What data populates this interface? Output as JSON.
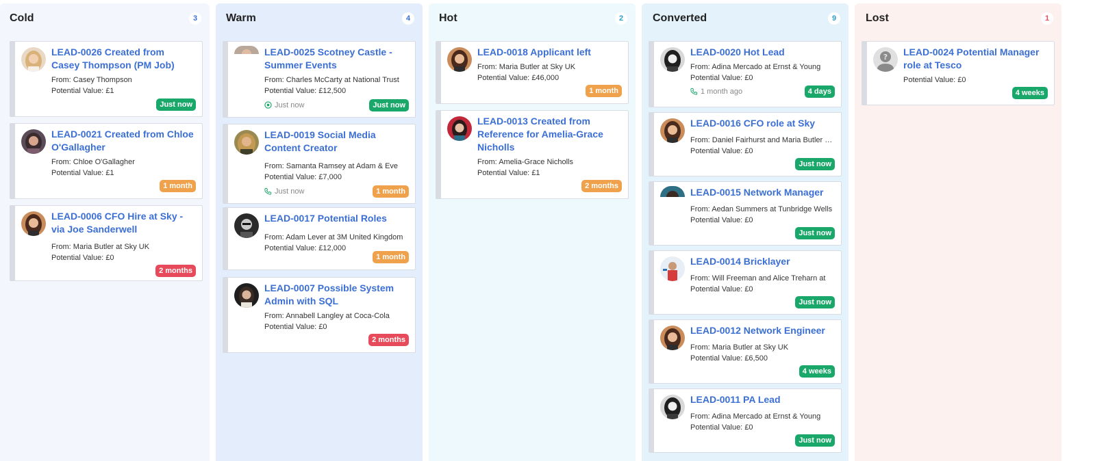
{
  "columns": [
    {
      "title": "Cold",
      "count": "3",
      "color": "#f3f6fd",
      "count_color": "#3b6fd4"
    },
    {
      "title": "Warm",
      "count": "4",
      "color": "#e4edfb",
      "count_color": "#3b6fd4"
    },
    {
      "title": "Hot",
      "count": "2",
      "color": "#eef9fd",
      "count_color": "#2b9fcf"
    },
    {
      "title": "Converted",
      "count": "9",
      "color": "#e3f2fb",
      "count_color": "#2b9fcf"
    },
    {
      "title": "Lost",
      "count": "1",
      "color": "#fdf1f0",
      "count_color": "#e74a5a"
    }
  ],
  "cards": {
    "cold": [
      {
        "title": "LEAD-0026 Created from Casey Thompson (PM Job)",
        "from_label": "From:",
        "from": "Casey Thompson",
        "value_label": "Potential Value:",
        "value": "£1",
        "badge": "Just now",
        "badge_color": "green",
        "avatar": "woman-blonde-avatar"
      },
      {
        "title": "LEAD-0021 Created from Chloe O'Gallagher",
        "from_label": "From:",
        "from": "Chloe O'Gallagher",
        "value_label": "Potential Value:",
        "value": "£1",
        "badge": "1 month",
        "badge_color": "orange",
        "avatar": "woman-dark-avatar"
      },
      {
        "title": "LEAD-0006 CFO Hire at Sky - via Joe Sanderwell",
        "from_label": "From:",
        "from": "Maria Butler at Sky UK",
        "value_label": "Potential Value:",
        "value": "£0",
        "badge": "2 months",
        "badge_color": "red",
        "avatar": "woman-brown-avatar"
      }
    ],
    "warm": [
      {
        "title": "LEAD-0025 Scotney Castle - Summer Events",
        "from_label": "From:",
        "from": "Charles McCarty at National Trust",
        "value_label": "Potential Value:",
        "value": "£12,500",
        "activity": "Just now",
        "activity_icon": "target-icon",
        "badge": "Just now",
        "badge_color": "green",
        "avatar": "man-avatar"
      },
      {
        "title": "LEAD-0019 Social Media Content Creator",
        "from_label": "From:",
        "from": "Samanta Ramsey at Adam & Eve",
        "value_label": "Potential Value:",
        "value": "£7,000",
        "activity": "Just now",
        "activity_icon": "phone-icon",
        "badge": "1 month",
        "badge_color": "orange",
        "avatar": "woman-blonde-avatar"
      },
      {
        "title": "LEAD-0017 Potential Roles",
        "from_label": "From:",
        "from": "Adam Lever at 3M United Kingdom",
        "value_label": "Potential Value:",
        "value": "£12,000",
        "badge": "1 month",
        "badge_color": "orange",
        "avatar": "man-dark-avatar"
      },
      {
        "title": "LEAD-0007 Possible System Admin with SQL",
        "from_label": "From:",
        "from": "Annabell Langley at Coca-Cola",
        "value_label": "Potential Value:",
        "value": "£0",
        "badge": "2 months",
        "badge_color": "red",
        "avatar": "woman-dark-avatar"
      }
    ],
    "hot": [
      {
        "title": "LEAD-0018 Applicant left",
        "from_label": "From:",
        "from": "Maria Butler at Sky UK",
        "value_label": "Potential Value:",
        "value": "£46,000",
        "badge": "1 month",
        "badge_color": "orange",
        "avatar": "woman-brown-avatar"
      },
      {
        "title": "LEAD-0013 Created from Reference for Amelia-Grace Nicholls",
        "from_label": "From:",
        "from": "Amelia-Grace Nicholls",
        "value_label": "Potential Value:",
        "value": "£1",
        "badge": "2 months",
        "badge_color": "orange",
        "avatar": "woman-red-avatar"
      }
    ],
    "converted": [
      {
        "title": "LEAD-0020 Hot Lead",
        "from_label": "From:",
        "from": "Adina Mercado at Ernst & Young",
        "value_label": "Potential Value:",
        "value": "£0",
        "activity": "1 month ago",
        "activity_icon": "phone-icon",
        "badge": "4 days",
        "badge_color": "green",
        "avatar": "woman-bw-avatar"
      },
      {
        "title": "LEAD-0016 CFO role at Sky",
        "from_label": "From:",
        "from": "Daniel Fairhurst and Maria Butler at Sky UK",
        "value_label": "Potential Value:",
        "value": "£0",
        "badge": "Just now",
        "badge_color": "green",
        "avatar": "woman-brown-avatar"
      },
      {
        "title": "LEAD-0015 Network Manager",
        "from_label": "From:",
        "from": "Aedan Summers at Tunbridge Wells",
        "value_label": "Potential Value:",
        "value": "£0",
        "badge": "Just now",
        "badge_color": "green",
        "avatar": "man-teal-avatar"
      },
      {
        "title": "LEAD-0014 Bricklayer",
        "from_label": "From:",
        "from": "Will Freeman and Alice Treharn at",
        "value_label": "Potential Value:",
        "value": "£0",
        "badge": "Just now",
        "badge_color": "green",
        "avatar": "man-sport-avatar"
      },
      {
        "title": "LEAD-0012 Network Engineer",
        "from_label": "From:",
        "from": "Maria Butler at Sky UK",
        "value_label": "Potential Value:",
        "value": "£6,500",
        "badge": "4 weeks",
        "badge_color": "green",
        "avatar": "woman-brown-avatar"
      },
      {
        "title": "LEAD-0011 PA Lead",
        "from_label": "From:",
        "from": "Adina Mercado at Ernst & Young",
        "value_label": "Potential Value:",
        "value": "£0",
        "badge": "Just now",
        "badge_color": "green",
        "avatar": "woman-bw-avatar"
      }
    ],
    "lost": [
      {
        "title": "LEAD-0024 Potential Manager role at Tesco",
        "value_label": "Potential Value:",
        "value": "£0",
        "badge": "4 weeks",
        "badge_color": "green",
        "avatar": "unknown-user-avatar"
      }
    ]
  }
}
